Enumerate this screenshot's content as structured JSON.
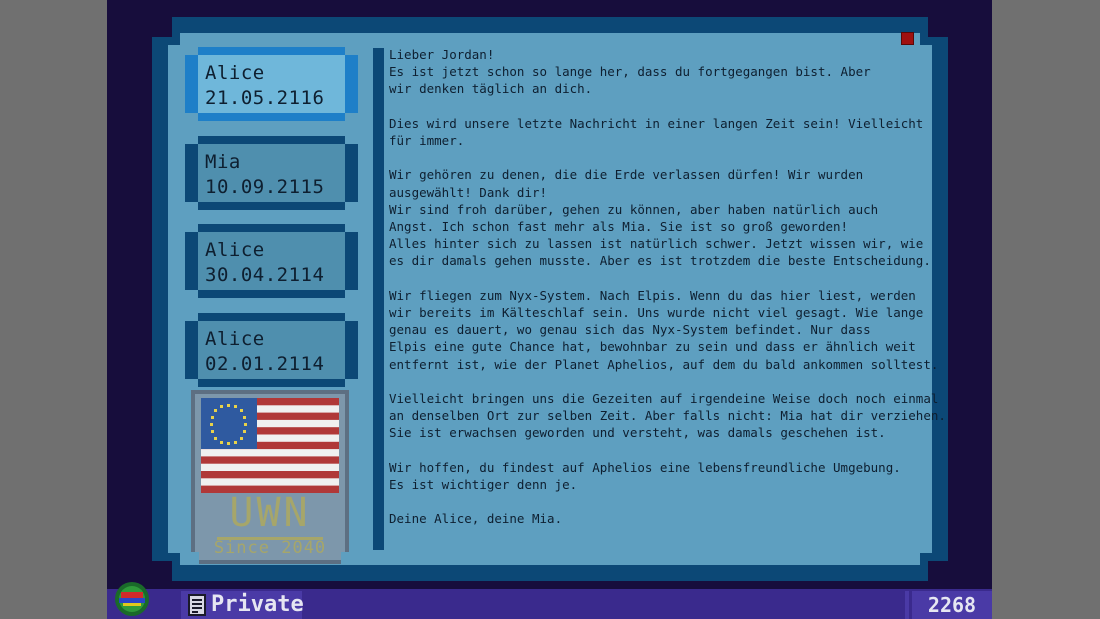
{
  "messages": [
    {
      "name": "Alice",
      "date": "21.05.2116",
      "selected": true
    },
    {
      "name": "Mia",
      "date": "10.09.2115",
      "selected": false
    },
    {
      "name": "Alice",
      "date": "30.04.2114",
      "selected": false
    },
    {
      "name": "Alice",
      "date": "02.01.2114",
      "selected": false
    }
  ],
  "badge": {
    "title": "UWN",
    "subtitle": "Since 2040"
  },
  "letter": {
    "lines": [
      "Lieber Jordan!",
      "Es ist jetzt schon so lange her, dass du fortgegangen bist. Aber",
      "wir denken täglich an dich.",
      "",
      "Dies wird unsere letzte Nachricht in einer langen Zeit sein! Vielleicht",
      "für immer.",
      "",
      "Wir gehören zu denen, die die Erde verlassen dürfen! Wir wurden",
      "ausgewählt! Dank dir!",
      "Wir sind froh darüber, gehen zu können, aber haben natürlich auch",
      "Angst. Ich schon fast mehr als Mia. Sie ist so groß geworden!",
      "Alles hinter sich zu lassen ist natürlich schwer. Jetzt wissen wir, wie",
      "es dir damals gehen musste. Aber es ist trotzdem die beste Entscheidung.",
      "",
      "Wir fliegen zum Nyx-System. Nach Elpis. Wenn du das hier liest, werden",
      "wir bereits im Kälteschlaf sein. Uns wurde nicht viel gesagt. Wie lange",
      "genau es dauert, wo genau sich das Nyx-System befindet. Nur dass",
      "Elpis eine gute Chance hat, bewohnbar zu sein und dass er ähnlich weit",
      "entfernt ist, wie der Planet Aphelios, auf dem du bald ankommen solltest.",
      "",
      "Vielleicht bringen uns die Gezeiten auf irgendeine Weise doch noch einmal",
      "an denselben Ort zur selben Zeit. Aber falls nicht: Mia hat dir verziehen.",
      "Sie ist erwachsen geworden und versteht, was damals geschehen ist.",
      "",
      "Wir hoffen, du findest auf Aphelios eine lebensfreundliche Umgebung.",
      "Es ist wichtiger denn je.",
      "",
      "Deine Alice, deine Mia."
    ]
  },
  "bottom_bar": {
    "privacy_label": "Private",
    "score": "2268",
    "globe_icon": "globe-icon",
    "doc_icon": "document-icon"
  },
  "colors": {
    "screen_bg": "#170d3c",
    "frame_dark": "#0c4876",
    "frame_light": "#5e9fc0",
    "selected_item": "#6fb7da",
    "bar": "#3a2a8d",
    "close_square": "#a01010"
  }
}
